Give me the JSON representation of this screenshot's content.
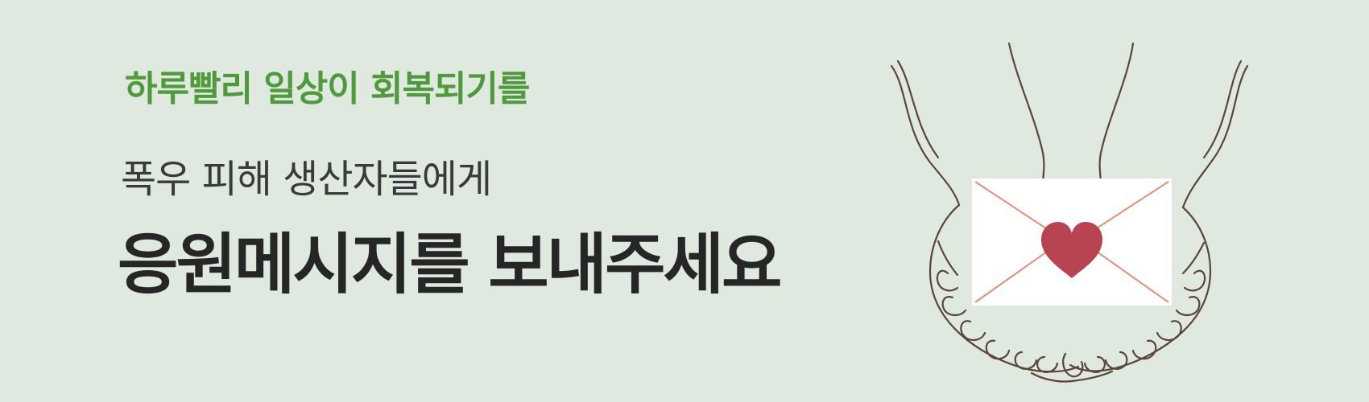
{
  "banner": {
    "eyebrow": "하루빨리 일상이 회복되기를",
    "subtitle": "폭우 피해 생산자들에게",
    "headline": "응원메시지를 보내주세요"
  },
  "illustration": {
    "icon": "hands-holding-heart-envelope-icon",
    "colors": {
      "background": "#e0e9e0",
      "eyebrow_text": "#4f9a3c",
      "heart": "#b84452",
      "envelope_lines": "#e0907a",
      "hands_outline": "#5a4638"
    }
  }
}
